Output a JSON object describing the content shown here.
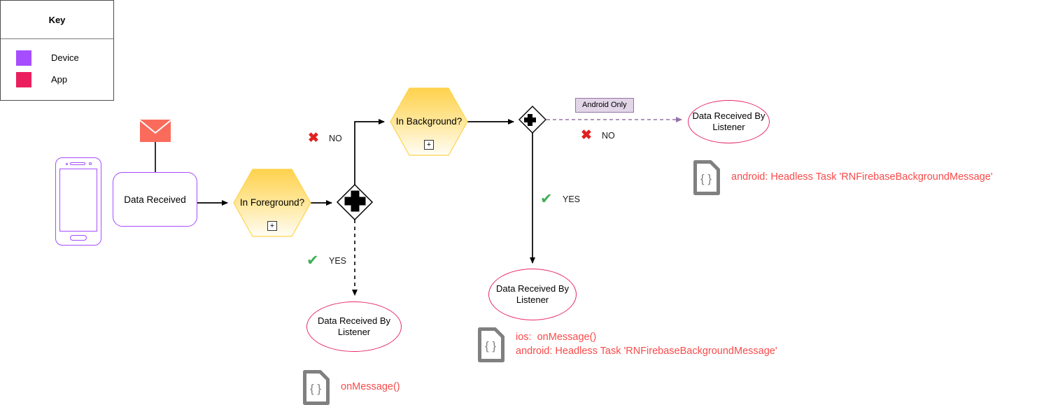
{
  "key": {
    "title": "Key",
    "items": [
      {
        "label": "Device",
        "color": "#a64dff"
      },
      {
        "label": "App",
        "color": "#eb1f5e"
      }
    ]
  },
  "nodes": {
    "device_icon": "phone-icon",
    "message_icon": "envelope-icon",
    "data_received": "Data Received",
    "in_foreground": "In Foreground?",
    "in_background": "In Background?",
    "gateway_plus": "+",
    "subprocess_marker": "+",
    "listener_left": "Data Received By Listener",
    "listener_center": "Data Received By Listener",
    "listener_right": "Data Received By Listener"
  },
  "decisions": {
    "foreground_no": {
      "label": "NO",
      "mark": "✖"
    },
    "foreground_yes": {
      "label": "YES",
      "mark": "✔"
    },
    "background_yes": {
      "label": "YES",
      "mark": "✔"
    },
    "background_no": {
      "label": "NO",
      "mark": "✖"
    }
  },
  "badges": {
    "android_only": "Android Only"
  },
  "annotations": {
    "left": {
      "icon": "code-file-icon",
      "lines": "onMessage()"
    },
    "center": {
      "icon": "code-file-icon",
      "lines": "ios:  onMessage()\nandroid: Headless Task 'RNFirebaseBackgroundMessage'"
    },
    "right": {
      "icon": "code-file-icon",
      "lines": "android: Headless Task 'RNFirebaseBackgroundMessage'"
    }
  },
  "colors": {
    "device": "#a64dff",
    "app": "#eb1f5e",
    "annotation_text": "#fa4a4a",
    "hexagon_top": "#ffd24d",
    "hexagon_bottom": "#fffdf2",
    "envelope": "#fa6b5c",
    "yes_mark": "#3faf55",
    "no_mark": "#e02020",
    "android_badge_bg": "#e1d5e7",
    "android_badge_border": "#9673a6",
    "flow_line": "#000000",
    "message_flow": "#9673a6"
  }
}
